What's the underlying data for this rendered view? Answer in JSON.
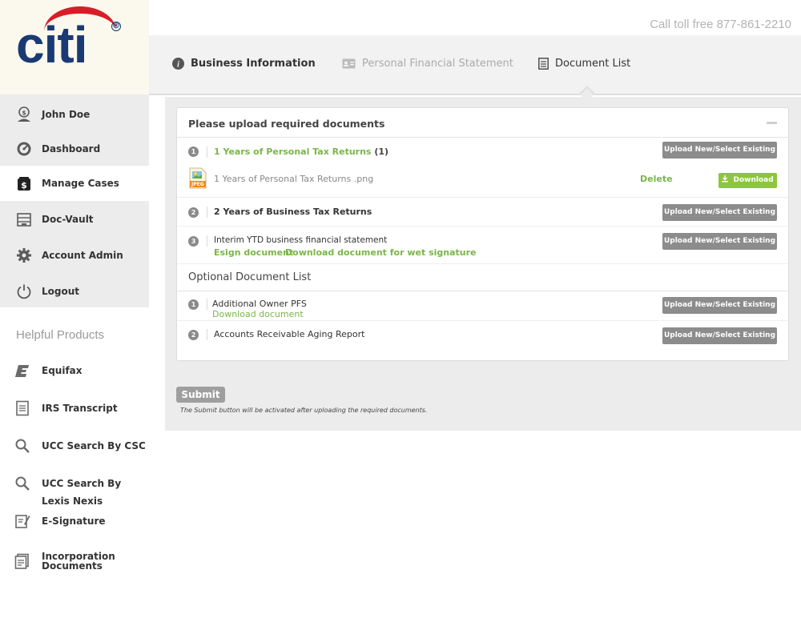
{
  "brand": {
    "logo": "citi",
    "registered": "®"
  },
  "header": {
    "tollfree": "Call toll free 877-861-2210"
  },
  "tabs": [
    {
      "label": "Business Information",
      "icon": "info-icon"
    },
    {
      "label": "Personal Financial Statement",
      "icon": "id-card-icon"
    },
    {
      "label": "Document List",
      "icon": "document-icon"
    }
  ],
  "sidebar": {
    "items": [
      {
        "label": "John Doe",
        "icon": "user-dollar-icon"
      },
      {
        "label": "Dashboard",
        "icon": "dashboard-icon"
      },
      {
        "label": "Manage Cases",
        "icon": "money-bag-icon"
      },
      {
        "label": "Doc-Vault",
        "icon": "vault-icon"
      },
      {
        "label": "Account Admin",
        "icon": "gear-icon"
      },
      {
        "label": "Logout",
        "icon": "power-icon"
      }
    ],
    "helpful_title": "Helpful Products",
    "products": [
      {
        "label": "Equifax",
        "icon": "equifax-icon"
      },
      {
        "label": "IRS Transcript",
        "icon": "document-icon"
      },
      {
        "label": "UCC Search By CSC",
        "icon": "search-icon"
      },
      {
        "label": "UCC Search By Lexis Nexis",
        "icon": "search-icon"
      },
      {
        "label": "E-Signature",
        "icon": "signature-icon"
      },
      {
        "label": "Incorporation Documents",
        "icon": "certificate-icon"
      }
    ]
  },
  "card": {
    "title": "Please upload required documents",
    "required": [
      {
        "num": "1",
        "title": "1 Years of Personal Tax Returns",
        "count": "(1)"
      },
      {
        "num": "2",
        "title": "2 Years of Business Tax Returns"
      },
      {
        "num": "3",
        "title": "Interim YTD business financial statement"
      }
    ],
    "file": {
      "name": "1 Years of Personal Tax Returns .png",
      "type_label": "JPEG",
      "delete": "Delete",
      "download": "Download"
    },
    "esign_link": "Esign document",
    "wet_link": "Download document for wet signature",
    "upload_label": "Upload New/Select Existing",
    "optional_title": "Optional Document List",
    "optional": [
      {
        "num": "1",
        "title": "Additional Owner PFS",
        "link": "Download document"
      },
      {
        "num": "2",
        "title": "Accounts Receivable Aging Report"
      }
    ]
  },
  "submit": {
    "label": "Submit",
    "note": "The Submit button will be activated after uploading the required documents."
  }
}
